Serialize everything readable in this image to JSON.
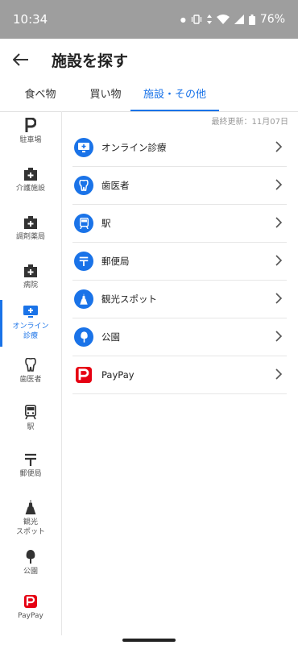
{
  "status": {
    "time": "10:34",
    "battery": "76%"
  },
  "header": {
    "title": "施設を探す"
  },
  "tabs": [
    {
      "label": "食べ物"
    },
    {
      "label": "買い物"
    },
    {
      "label": "施設・その他"
    }
  ],
  "updated": "最終更新：11月07日",
  "sidebar": [
    {
      "label": "駐車場",
      "icon": "parking-icon"
    },
    {
      "label": "介護施設",
      "icon": "care-facility-icon"
    },
    {
      "label": "調剤薬局",
      "icon": "pharmacy-icon"
    },
    {
      "label": "病院",
      "icon": "hospital-icon"
    },
    {
      "label": "オンライン\n診療",
      "icon": "online-clinic-icon"
    },
    {
      "label": "歯医者",
      "icon": "tooth-icon"
    },
    {
      "label": "駅",
      "icon": "train-icon"
    },
    {
      "label": "郵便局",
      "icon": "post-office-icon"
    },
    {
      "label": "観光\nスポット",
      "icon": "tower-icon"
    },
    {
      "label": "公園",
      "icon": "tree-icon"
    },
    {
      "label": "PayPay",
      "icon": "paypay-icon"
    }
  ],
  "list": [
    {
      "label": "オンライン診療",
      "icon": "online-clinic-icon"
    },
    {
      "label": "歯医者",
      "icon": "tooth-icon"
    },
    {
      "label": "駅",
      "icon": "train-icon"
    },
    {
      "label": "郵便局",
      "icon": "post-office-icon"
    },
    {
      "label": "観光スポット",
      "icon": "tower-icon"
    },
    {
      "label": "公園",
      "icon": "tree-icon"
    },
    {
      "label": "PayPay",
      "icon": "paypay-icon"
    }
  ],
  "colors": {
    "accent": "#1a73e8",
    "paypay": "#e60012",
    "statusbar": "#9e9e9e"
  }
}
